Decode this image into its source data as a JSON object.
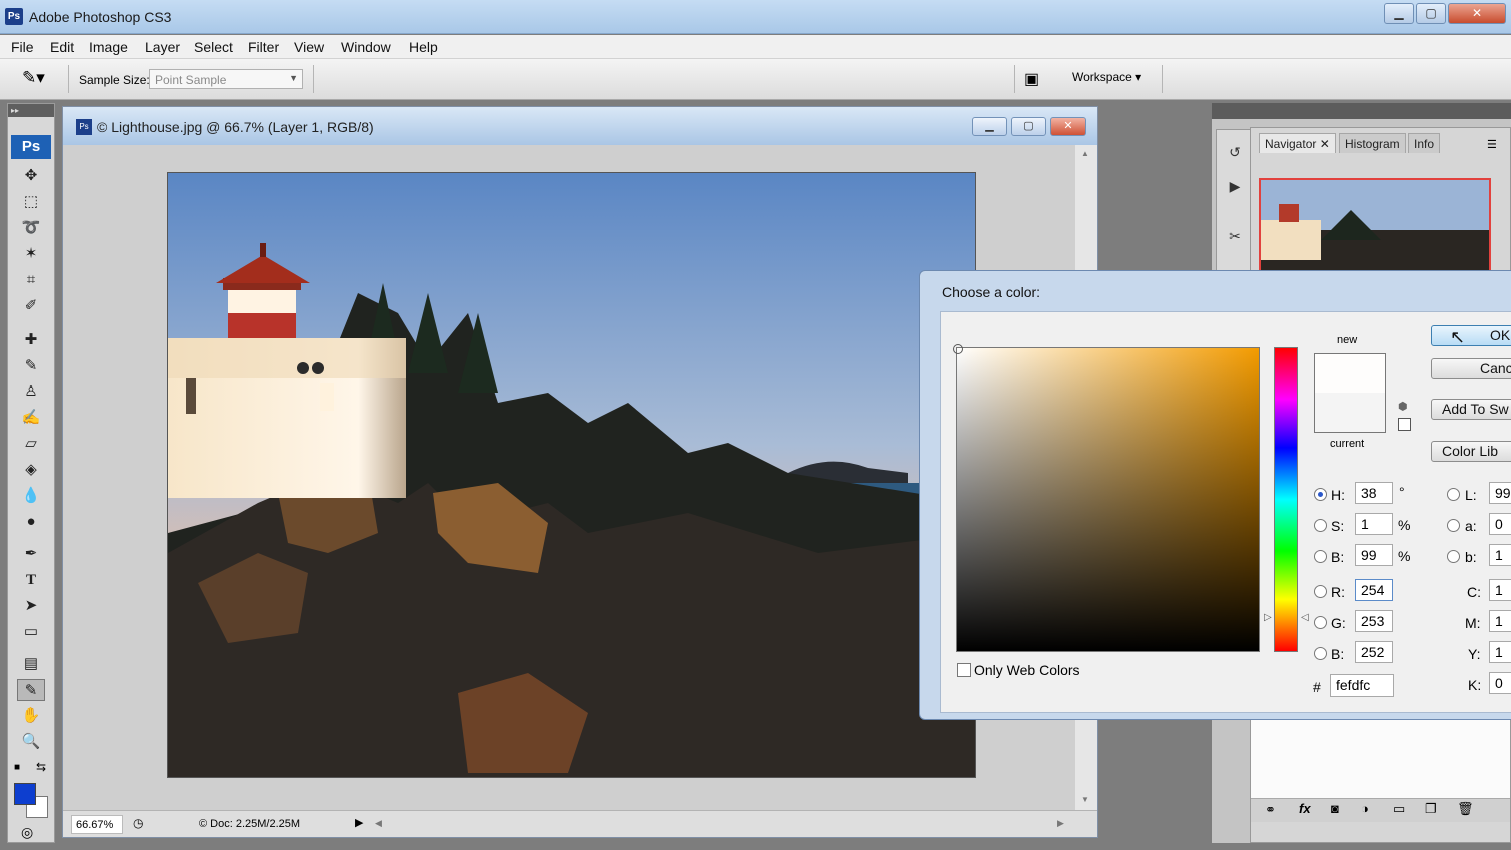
{
  "window": {
    "title": "Adobe Photoshop CS3",
    "app_icon": "Ps"
  },
  "menu": [
    "File",
    "Edit",
    "Image",
    "Layer",
    "Select",
    "Filter",
    "View",
    "Window",
    "Help"
  ],
  "options": {
    "sample_size_label": "Sample Size:",
    "sample_size_value": "Point Sample",
    "workspace_label": "Workspace"
  },
  "toolbox": {
    "logo": "Ps",
    "fg_color": "#0d3ecf",
    "bg_color": "#ffffff"
  },
  "document": {
    "title": "© Lighthouse.jpg @ 66.7% (Layer 1, RGB/8)",
    "zoom": "66.67%",
    "doc_size": "© Doc: 2.25M/2.25M"
  },
  "panels": {
    "tabs": [
      "Navigator",
      "Histogram",
      "Info"
    ]
  },
  "color_picker": {
    "title": "Choose a color:",
    "new_label": "new",
    "current_label": "current",
    "new_color": "#fefdfc",
    "current_color": "#f4f4f4",
    "buttons": {
      "ok": "OK",
      "cancel": "Canc",
      "add_swatches": "Add To Sw",
      "color_libraries": "Color Lib"
    },
    "hsb": {
      "h_label": "H:",
      "h": "38",
      "h_unit": "°",
      "s_label": "S:",
      "s": "1",
      "s_unit": "%",
      "b_label": "B:",
      "b": "99",
      "b_unit": "%"
    },
    "rgb": {
      "r_label": "R:",
      "r": "254",
      "g_label": "G:",
      "g": "253",
      "b_label": "B:",
      "b": "252"
    },
    "lab": {
      "l_label": "L:",
      "l": "99",
      "a_label": "a:",
      "a": "0",
      "b_label": "b:",
      "b": "1"
    },
    "cmyk": {
      "c_label": "C:",
      "c": "1",
      "m_label": "M:",
      "m": "1",
      "y_label": "Y:",
      "y": "1",
      "k_label": "K:",
      "k": "0"
    },
    "hex_label": "#",
    "hex": "fefdfc",
    "only_web_colors": "Only Web Colors"
  }
}
